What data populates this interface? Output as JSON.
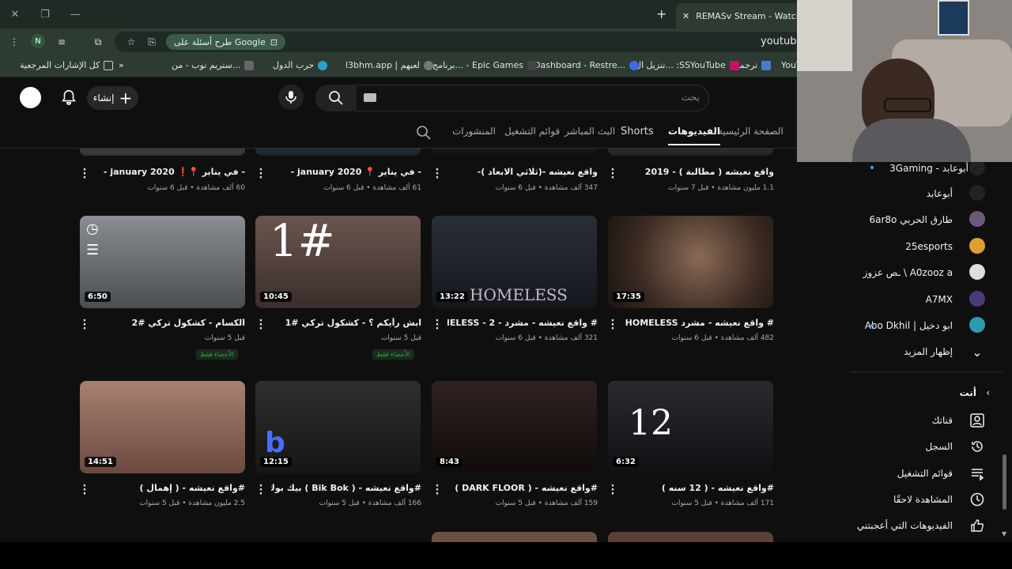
{
  "browser": {
    "tab_title": "REMASv Stream - Watch Live",
    "tab_close": "✕",
    "new_tab": "+",
    "url": "youtube.",
    "google_chip": "طرح أسئلة على Google",
    "profile_initial": "N"
  },
  "bookmarks": [
    {
      "label": "YouTu"
    },
    {
      "label": "ترجمة"
    },
    {
      "label": "تنزيل ال... :SSYouTube"
    },
    {
      "label": "Dashboard - Restre..."
    },
    {
      "label": "برنامج... - Epic Games"
    },
    {
      "label": "l3bhm.app | لعبهم"
    },
    {
      "label": "حرب الدول"
    },
    {
      "label": "ستريم توب - من..."
    },
    {
      "label": "كل الإشارات المرجعية"
    }
  ],
  "header": {
    "search_placeholder": "بحث",
    "create_label": "إنشاء"
  },
  "channel_tabs": [
    {
      "label": "الصفحة الرئيسية"
    },
    {
      "label": "الفيديوهات"
    },
    {
      "label": "Shorts"
    },
    {
      "label": "البث المباشر"
    },
    {
      "label": "قوائم التشغيل"
    },
    {
      "label": "المنشورات"
    }
  ],
  "videos_row0": [
    {
      "title": "واقع نعيشه ( مطالبة ) - 2019",
      "meta": "1.1 مليون مشاهدة • قبل 7 سنوات"
    },
    {
      "title": "واقع نعيشه -(ثلاثي الابعاد )-",
      "meta": "347 ألف مشاهدة • قبل 6 سنوات"
    },
    {
      "title": "- في يناير 📍 january 2020 -",
      "meta": "61 ألف مشاهدة • قبل 6 سنوات"
    },
    {
      "title": "- في يناير 📍❗ january 2020 -",
      "meta": "60 ألف مشاهدة • قبل 6 سنوات"
    }
  ],
  "videos_row1": [
    {
      "title": "# واقع نعيشه - مشرد HOMELESS",
      "meta": "482 ألف مشاهدة • قبل 6 سنوات",
      "duration": "17:35"
    },
    {
      "title": "# واقع نعيشه - مشرد - 2 - HOMELESS",
      "meta": "321 ألف مشاهدة • قبل 6 سنوات",
      "duration": "13:22"
    },
    {
      "title": "ابش رأيكم ؟ - كشكول تركي #1",
      "meta": "قبل 5 سنوات",
      "duration": "10:45",
      "members": "الأعضاء فقط"
    },
    {
      "title": "الكسام - كشكول تركي #2",
      "meta": "قبل 5 سنوات",
      "duration": "6:50",
      "members": "الأعضاء فقط"
    }
  ],
  "videos_row2": [
    {
      "title": "#واقع نعيشه - ( 12 سنه )",
      "meta": "171 ألف مشاهدة • قبل 5 سنوات",
      "duration": "6:32"
    },
    {
      "title": "#واقع نعيشه - ( DARK FLOOR )",
      "meta": "159 ألف مشاهدة • قبل 5 سنوات",
      "duration": "8:43"
    },
    {
      "title": "#واقع نعيشه - ( Bik Bok ) بيك بوك",
      "meta": "166 ألف مشاهدة • قبل 5 سنوات",
      "duration": "12:15"
    },
    {
      "title": "#واقع نعيشه - ( إهمال )",
      "meta": "2.5 مليون مشاهدة • قبل 5 سنوات",
      "duration": "14:51"
    }
  ],
  "sidebar": {
    "subscriptions": [
      {
        "label": "أبوعابد - 3Gaming"
      },
      {
        "label": "أبوعابد"
      },
      {
        "label": "طارق الحربي 6ar8o"
      },
      {
        "label": "25esports"
      },
      {
        "label": "A0zooz a \\ ـص عزوز"
      },
      {
        "label": "A7MX"
      },
      {
        "label": "ابو دخيل | Abo Dkhil"
      }
    ],
    "show_more": "إظهار المزيد",
    "you_heading": "أنت",
    "you_items": [
      {
        "label": "قناتك",
        "icon": "account-box-icon"
      },
      {
        "label": "السجل",
        "icon": "history-icon"
      },
      {
        "label": "قوائم التشغيل",
        "icon": "playlists-icon"
      },
      {
        "label": "المشاهدة لاحقًا",
        "icon": "watch-later-icon"
      },
      {
        "label": "الفيديوهات التي أعجبتني",
        "icon": "thumbs-up-icon"
      }
    ]
  }
}
